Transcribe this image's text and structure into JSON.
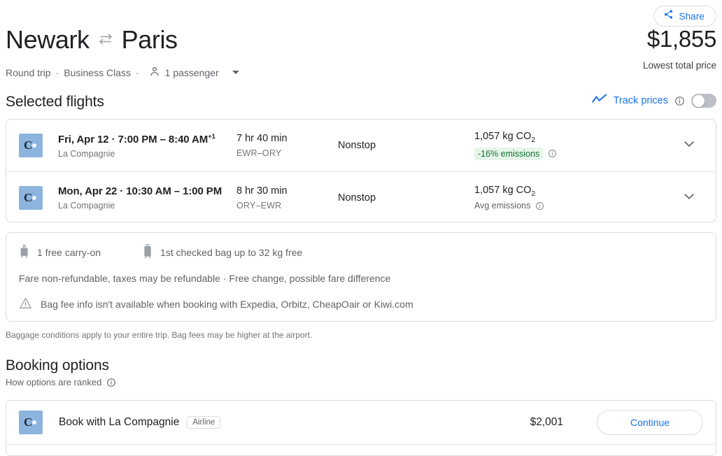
{
  "share": {
    "label": "Share",
    "icon": "share-icon"
  },
  "header": {
    "origin": "Newark",
    "destination": "Paris",
    "swap_icon": "swap-arrows-icon",
    "trip_type": "Round trip",
    "cabin_class": "Business Class",
    "passengers": "1 passenger",
    "separator": "·"
  },
  "price_summary": {
    "amount": "$1,855",
    "caption": "Lowest total price"
  },
  "selected_flights": {
    "title": "Selected flights",
    "track_prices_label": "Track prices",
    "track_prices_on": false,
    "rows": [
      {
        "airline_logo": "la-compagnie-logo",
        "when": "Fri, Apr 12  ·  7:00 PM – 8:40 AM",
        "day_offset": "+1",
        "airline": "La Compagnie",
        "duration": "7 hr 40 min",
        "airports": "EWR–ORY",
        "stops": "Nonstop",
        "co2": "1,057 kg CO",
        "co2_sub": "2",
        "emissions_badge": "-16% emissions",
        "emissions_avg": ""
      },
      {
        "airline_logo": "la-compagnie-logo",
        "when": "Mon, Apr 22  ·  10:30 AM – 1:00 PM",
        "day_offset": "",
        "airline": "La Compagnie",
        "duration": "8 hr 30 min",
        "airports": "ORY–EWR",
        "stops": "Nonstop",
        "co2": "1,057 kg CO",
        "co2_sub": "2",
        "emissions_badge": "",
        "emissions_avg": "Avg emissions"
      }
    ]
  },
  "baggage": {
    "carry_on": "1 free carry-on",
    "checked": "1st checked bag up to 32 kg free",
    "fare_terms": "Fare non-refundable, taxes may be refundable · Free change, possible fare difference",
    "warning": "Bag fee info isn't available when booking with Expedia, Orbitz, CheapOair or Kiwi.com",
    "footnote": "Baggage conditions apply to your entire trip. Bag fees may be higher at the airport."
  },
  "booking_options": {
    "title": "Booking options",
    "ranked_label": "How options are ranked",
    "rows": [
      {
        "logo": "la-compagnie-logo",
        "label": "Book with La Compagnie",
        "chip": "Airline",
        "price": "$2,001",
        "cta": "Continue"
      }
    ]
  },
  "colors": {
    "accent_blue": "#1a73e8",
    "logo_blue": "#8cb4de",
    "green_badge_bg": "#e6f4ea",
    "green_badge_text": "#137333",
    "border": "#dadce0"
  }
}
